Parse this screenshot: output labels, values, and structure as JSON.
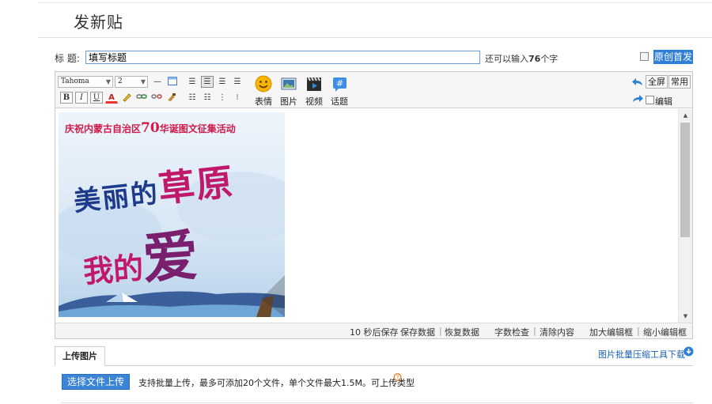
{
  "page": {
    "title": "发新贴"
  },
  "subject": {
    "label": "标  题:",
    "value": "填写标题",
    "remaining_prefix": "还可以输入",
    "remaining_count": "76",
    "remaining_suffix": "个字"
  },
  "original": {
    "label": "原创首发"
  },
  "toolbar": {
    "font_name": "Tahoma",
    "font_size": "2",
    "bold": "B",
    "italic": "I",
    "underline": "U",
    "color": "A",
    "emoji_label": "表情",
    "image_label": "图片",
    "video_label": "视频",
    "topic_label": "话题",
    "fullscreen_label": "全屏",
    "common_label": "常用",
    "edit_html_label": "编辑HTML"
  },
  "poster": {
    "header": "庆祝内蒙古自治区",
    "number": "70",
    "header_tail": "华诞图文征集活动",
    "line1a": "美丽的",
    "line1b": "草原",
    "line2a": "我的",
    "line2b": "爱"
  },
  "statusbar": {
    "autosave": "10 秒后保存",
    "save": "保存数据",
    "restore": "恢复数据",
    "count": "字数检查",
    "clear": "清除内容",
    "enlarge": "加大编辑框",
    "shrink": "缩小编辑框"
  },
  "upload": {
    "tab_label": "上传图片",
    "compress_link": "图片批量压缩工具下载",
    "choose_button": "选择文件上传",
    "hint": "支持批量上传，最多可添加20个文件，单个文件最大1.5M。可上传类型"
  },
  "colors": {
    "accent": "#2f7fd6",
    "link": "#1a5fb4",
    "poster_red": "#d01a4a",
    "poster_blue": "#1e3a8a",
    "poster_magenta": "#c0186a"
  }
}
